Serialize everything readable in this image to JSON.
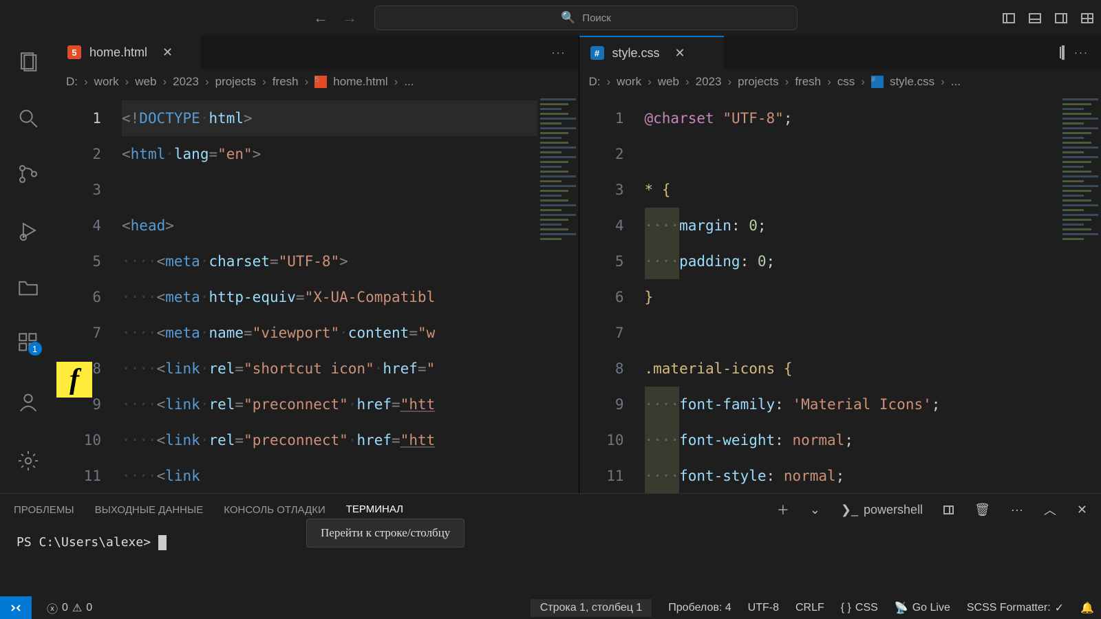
{
  "titlebar": {
    "search_placeholder": "Поиск"
  },
  "activity": {
    "ext_badge": "1"
  },
  "pane1": {
    "tab_label": "home.html",
    "breadcrumb": [
      "D:",
      "work",
      "web",
      "2023",
      "projects",
      "fresh",
      "home.html",
      "..."
    ],
    "code": [
      {
        "n": 1,
        "html": "<span class='p-gray'>&lt;!</span><span class='p-blue'>DOCTYPE</span><span class='ws'>·</span><span class='p-attr'>html</span><span class='p-gray'>&gt;</span>"
      },
      {
        "n": 2,
        "html": "<span class='p-gray'>&lt;</span><span class='p-blue'>html</span><span class='ws'>·</span><span class='p-attr'>lang</span><span class='p-gray'>=</span><span class='p-str'>\"en\"</span><span class='p-gray'>&gt;</span>"
      },
      {
        "n": 3,
        "html": ""
      },
      {
        "n": 4,
        "html": "<span class='p-gray'>&lt;</span><span class='p-blue'>head</span><span class='p-gray'>&gt;</span>"
      },
      {
        "n": 5,
        "html": "<span class='ws'>····</span><span class='p-gray'>&lt;</span><span class='p-blue'>meta</span><span class='ws'>·</span><span class='p-attr'>charset</span><span class='p-gray'>=</span><span class='p-str'>\"UTF-8\"</span><span class='p-gray'>&gt;</span>"
      },
      {
        "n": 6,
        "html": "<span class='ws'>····</span><span class='p-gray'>&lt;</span><span class='p-blue'>meta</span><span class='ws'>·</span><span class='p-attr'>http-equiv</span><span class='p-gray'>=</span><span class='p-str'>\"X-UA-Compatibl</span>"
      },
      {
        "n": 7,
        "html": "<span class='ws'>····</span><span class='p-gray'>&lt;</span><span class='p-blue'>meta</span><span class='ws'>·</span><span class='p-attr'>name</span><span class='p-gray'>=</span><span class='p-str'>\"viewport\"</span><span class='ws'>·</span><span class='p-attr'>content</span><span class='p-gray'>=</span><span class='p-str'>\"w</span>"
      },
      {
        "n": 8,
        "html": "<span class='ws'>····</span><span class='p-gray'>&lt;</span><span class='p-blue'>link</span><span class='ws'>·</span><span class='p-attr'>rel</span><span class='p-gray'>=</span><span class='p-str'>\"shortcut icon\"</span><span class='ws'>·</span><span class='p-attr'>href</span><span class='p-gray'>=</span><span class='p-str'>\"</span>"
      },
      {
        "n": 9,
        "html": "<span class='ws'>····</span><span class='p-gray'>&lt;</span><span class='p-blue'>link</span><span class='ws'>·</span><span class='p-attr'>rel</span><span class='p-gray'>=</span><span class='p-str'>\"preconnect\"</span><span class='ws'>·</span><span class='p-attr'>href</span><span class='p-gray'>=</span><span class='p-str p-link'>\"htt</span>"
      },
      {
        "n": 10,
        "html": "<span class='ws'>····</span><span class='p-gray'>&lt;</span><span class='p-blue'>link</span><span class='ws'>·</span><span class='p-attr'>rel</span><span class='p-gray'>=</span><span class='p-str'>\"preconnect\"</span><span class='ws'>·</span><span class='p-attr'>href</span><span class='p-gray'>=</span><span class='p-str p-link'>\"htt</span>"
      },
      {
        "n": 11,
        "html": "<span class='ws'>····</span><span class='p-gray'>&lt;</span><span class='p-blue'>link</span>"
      }
    ]
  },
  "pane2": {
    "tab_label": "style.css",
    "breadcrumb": [
      "D:",
      "work",
      "web",
      "2023",
      "projects",
      "fresh",
      "css",
      "style.css",
      "..."
    ],
    "code": [
      {
        "n": 1,
        "html": "<span class='p-kw'>@charset</span> <span class='p-str'>\"UTF-8\"</span>;"
      },
      {
        "n": 2,
        "html": ""
      },
      {
        "n": 3,
        "html": "<span class='p-sel'>*</span> <span class='p-sel'>{</span>"
      },
      {
        "n": 4,
        "html": "<span class='indent'>····</span><span class='p-attr'>margin</span>: <span class='p-num'>0</span>;"
      },
      {
        "n": 5,
        "html": "<span class='indent'>····</span><span class='p-attr'>padding</span>: <span class='p-num'>0</span>;"
      },
      {
        "n": 6,
        "html": "<span class='p-sel'>}</span>"
      },
      {
        "n": 7,
        "html": ""
      },
      {
        "n": 8,
        "html": "<span class='p-sel'>.material-icons</span> <span class='p-sel'>{</span>"
      },
      {
        "n": 9,
        "html": "<span class='indent'>····</span><span class='p-attr'>font-family</span>: <span class='p-str'>'Material Icons'</span>;"
      },
      {
        "n": 10,
        "html": "<span class='indent'>····</span><span class='p-attr'>font-weight</span>: <span class='p-str'>normal</span>;"
      },
      {
        "n": 11,
        "html": "<span class='indent'>····</span><span class='p-attr'>font-style</span>: <span class='p-str'>normal</span>;"
      }
    ]
  },
  "panel": {
    "tabs": {
      "problems": "ПРОБЛЕМЫ",
      "output": "ВЫХОДНЫЕ ДАННЫЕ",
      "debug": "КОНСОЛЬ ОТЛАДКИ",
      "terminal": "ТЕРМИНАЛ"
    },
    "shell_label": "powershell",
    "prompt": "PS C:\\Users\\alexe> ",
    "tooltip": "Перейти к строке/столбцу"
  },
  "status": {
    "errors": "0",
    "warnings": "0",
    "position": "Строка 1, столбец 1",
    "spaces": "Пробелов: 4",
    "encoding": "UTF-8",
    "eol": "CRLF",
    "lang": "CSS",
    "golive": "Go Live",
    "scss": "SCSS Formatter:"
  }
}
